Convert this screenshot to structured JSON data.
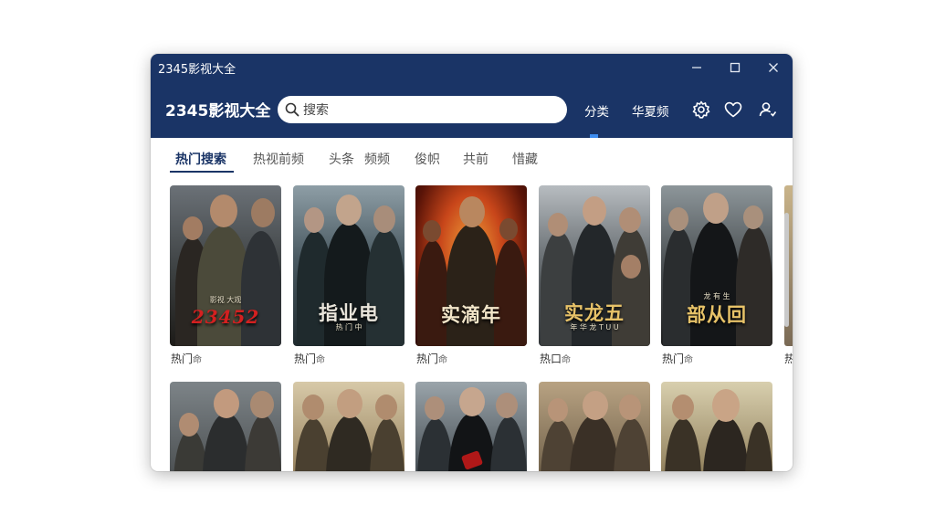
{
  "window": {
    "title": "2345影视大全",
    "controls": {
      "minimize": "—",
      "maximize": "☐",
      "close": "✕"
    }
  },
  "header": {
    "app_title": "2345影视大全",
    "search_placeholder": "搜索",
    "nav": [
      "分类",
      "华夏频"
    ],
    "icons": [
      "settings-gear-icon",
      "heart-icon",
      "user-icon"
    ]
  },
  "tabs": [
    "热门搜索",
    "热视前频",
    "头条",
    "频频",
    "俊帜",
    "共前",
    "惜藏"
  ],
  "active_tab": 0,
  "posters": [
    {
      "title": "23452",
      "subtitle": "影视 大观",
      "caption": "热门",
      "badge": "命",
      "title_color": "#d42020"
    },
    {
      "title": "指业电",
      "subtitle": "热 门 中",
      "caption": "热门",
      "badge": "命",
      "title_color": "#e8e4da"
    },
    {
      "title": "实滴年",
      "subtitle": "",
      "caption": "热门",
      "badge": "命",
      "title_color": "#f3e6c9"
    },
    {
      "title": "实龙五",
      "subtitle": "年 华 龙 T U U",
      "caption": "热口",
      "badge": "命",
      "title_color": "#e7c268"
    },
    {
      "title": "部从回",
      "subtitle": "龙 有 生",
      "caption": "热门",
      "badge": "命",
      "title_color": "#e7c268"
    }
  ],
  "edge_caption": "热",
  "colors": {
    "header": "#1a3466",
    "accent": "#3d8cf0",
    "background": "#ffffff"
  }
}
